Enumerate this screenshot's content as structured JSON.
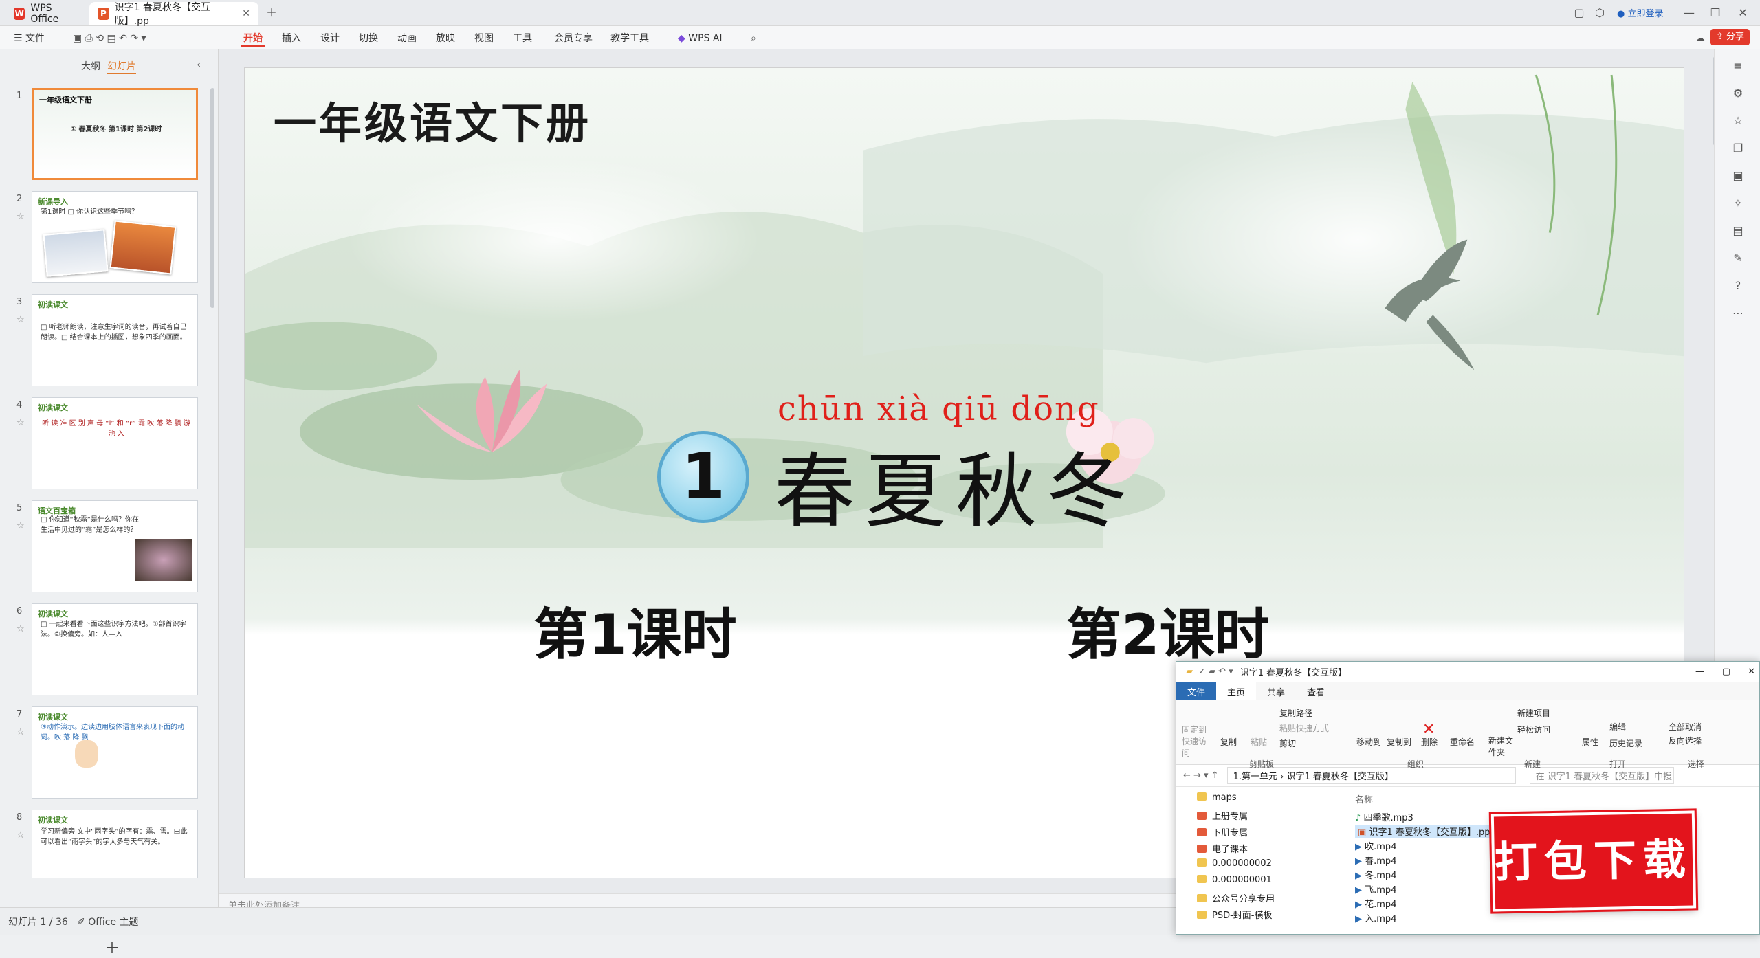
{
  "titlebar": {
    "app_tab": "WPS Office",
    "doc_tab": "识字1 春夏秋冬【交互版】.pp",
    "login": "立即登录"
  },
  "menu": {
    "file": "文件",
    "items": [
      "开始",
      "插入",
      "设计",
      "切换",
      "动画",
      "放映",
      "视图",
      "工具",
      "会员专享",
      "教学工具",
      "WPS AI"
    ],
    "share": "分享"
  },
  "left_panel": {
    "tab_outline": "大纲",
    "tab_slides": "幻灯片",
    "thumbs": [
      {
        "num": "1",
        "title": "一年级语文下册",
        "text": "① 春夏秋冬   第1课时   第2课时"
      },
      {
        "num": "2",
        "title": "新课导入",
        "text": "第1课时  □ 你认识这些季节吗？"
      },
      {
        "num": "3",
        "title": "初读课文",
        "text": "□ 听老师朗读，注意生字词的读音，再试着自己朗读。□ 结合课本上的插图，想象四季的画面。"
      },
      {
        "num": "4",
        "title": "初读课文",
        "text": "听 读 准 区 别 声 母 “l” 和 “r”  霜 吹 落 降 飘 游 池 入"
      },
      {
        "num": "5",
        "title": "语文百宝箱",
        "text": "□ 你知道“秋霜”是什么吗？你在生活中见过的“霜”是怎么样的？"
      },
      {
        "num": "6",
        "title": "初读课文",
        "text": "□ 一起来看看下面这些识字方法吧。①部首识字法。②换偏旁。如：人—入"
      },
      {
        "num": "7",
        "title": "初读课文",
        "text": "③动作演示。边读边用肢体语言来表现下面的动词。吹 落 降 飘"
      },
      {
        "num": "8",
        "title": "初读课文",
        "text": "学习新偏旁  文中“雨字头”的字有：霜、雪。由此可以看出“雨字头”的字大多与天气有关。"
      }
    ]
  },
  "slide": {
    "heading": "一年级语文下册",
    "lesson_number": "1",
    "pinyin": "chūn xià qiū dōng",
    "lesson_title": "春夏秋冬",
    "period1": "第1课时",
    "period2": "第2课时"
  },
  "notes": {
    "placeholder": "单击此处添加备注"
  },
  "status": {
    "slide_counter": "幻灯片 1 / 36",
    "theme": "Office 主题"
  },
  "explorer": {
    "title": "识字1 春夏秋冬【交互版】",
    "ribbon_tabs": [
      "文件",
      "主页",
      "共享",
      "查看"
    ],
    "ribbon_buttons": [
      "固定到快速访问",
      "复制",
      "粘贴",
      "复制路径",
      "粘贴快捷方式",
      "剪切",
      "移动到",
      "复制到",
      "删除",
      "重命名",
      "新建文件夹",
      "新建项目",
      "轻松访问",
      "属性",
      "编辑",
      "历史记录",
      "全部取消",
      "反向选择"
    ],
    "ribbon_groups": [
      "剪贴板",
      "组织",
      "新建",
      "打开",
      "选择"
    ],
    "address": "1.第一单元  ›  识字1 春夏秋冬【交互版】",
    "search_placeholder": "在 识字1 春夏秋冬【交互版】中搜...",
    "nav": [
      "maps",
      "上册专属",
      "下册专属",
      "电子课本",
      "0.000000002",
      "0.000000001",
      "公众号分享专用",
      "PSD-封面-横板"
    ],
    "column_name": "名称",
    "files": [
      "四季歌.mp3",
      "识字1 春夏秋冬【交互版】.pp",
      "吹.mp4",
      "春.mp4",
      "冬.mp4",
      "飞.mp4",
      "花.mp4",
      "入.mp4"
    ]
  },
  "badge": {
    "text": "打包下载"
  },
  "colors": {
    "accent": "#e33a2c",
    "pinyin_red": "#e0201a",
    "circle_blue": "#6ec4e4",
    "badge_red": "#e3141c",
    "thumb_title_green": "#4b8a2e"
  }
}
